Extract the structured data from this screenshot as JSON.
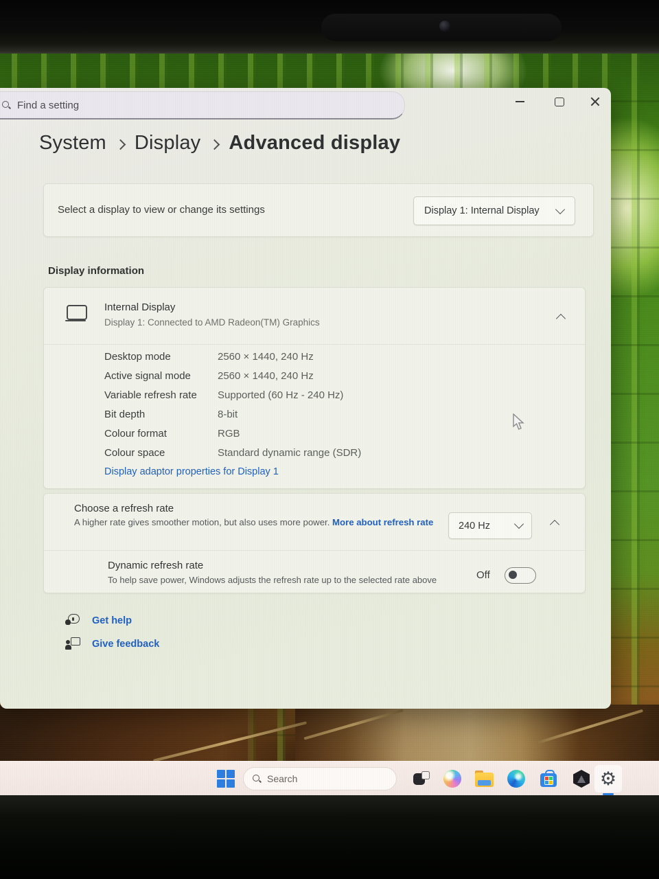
{
  "titlebar": {
    "search_placeholder": "Find a setting"
  },
  "breadcrumb": {
    "items": [
      "System",
      "Display",
      "Advanced display"
    ]
  },
  "display_selector": {
    "label": "Select a display to view or change its settings",
    "value": "Display 1: Internal Display"
  },
  "display_information": {
    "section_title": "Display information",
    "card_title": "Internal Display",
    "card_subtitle": "Display 1: Connected to AMD Radeon(TM) Graphics",
    "rows": [
      {
        "label": "Desktop mode",
        "value": "2560 × 1440, 240 Hz"
      },
      {
        "label": "Active signal mode",
        "value": "2560 × 1440, 240 Hz"
      },
      {
        "label": "Variable refresh rate",
        "value": "Supported (60 Hz - 240 Hz)"
      },
      {
        "label": "Bit depth",
        "value": "8-bit"
      },
      {
        "label": "Colour format",
        "value": "RGB"
      },
      {
        "label": "Colour space",
        "value": "Standard dynamic range (SDR)"
      }
    ],
    "adapter_link": "Display adaptor properties for Display 1"
  },
  "refresh_rate": {
    "title": "Choose a refresh rate",
    "description": "A higher rate gives smoother motion, but also uses more power. ",
    "more_link": "More about refresh rate",
    "selected_value": "240 Hz",
    "dynamic_refresh": {
      "title": "Dynamic refresh rate",
      "description": "To help save power, Windows adjusts the refresh rate up to the selected rate above",
      "toggle_state": "Off"
    }
  },
  "footer_links": {
    "get_help": "Get help",
    "give_feedback": "Give feedback"
  },
  "taskbar": {
    "search_placeholder": "Search",
    "settings_gear_glyph": "⚙",
    "icons": [
      "start",
      "search",
      "task-view",
      "copilot",
      "file-explorer",
      "edge",
      "microsoft-store",
      "hexagon-app",
      "settings"
    ]
  },
  "colors": {
    "link_blue": "#2060c4",
    "accent_blue": "#2b7de0",
    "card_bg": "#f1f2ea",
    "window_bg": "#e8ebdd",
    "taskbar_bg": "#f4ebe7"
  }
}
